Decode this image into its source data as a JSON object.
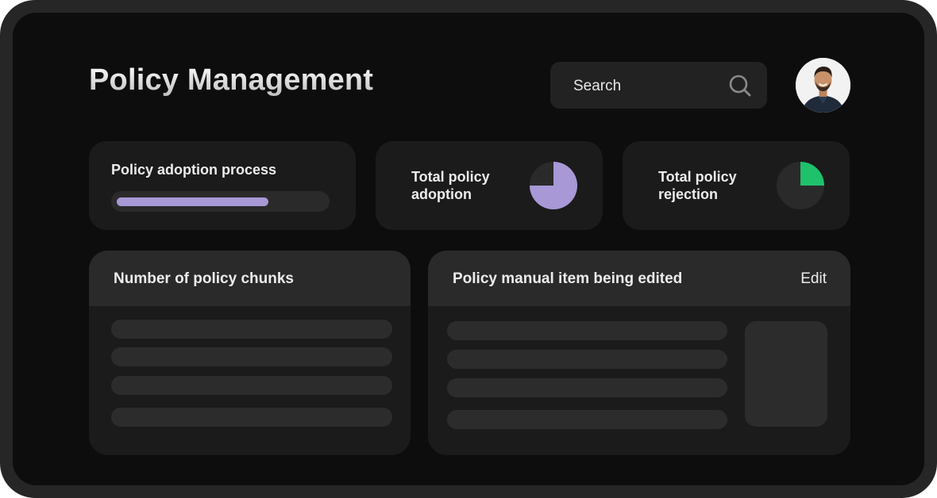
{
  "header": {
    "title": "Policy Management",
    "search_placeholder": "Search",
    "search_icon": "search-icon",
    "avatar_icon": "user-avatar"
  },
  "stats": {
    "adoption_process": {
      "label": "Policy adoption process",
      "progress_percent": 73,
      "color": "#a898d6"
    },
    "total_adoption": {
      "label_line1": "Total policy",
      "label_line2": "adoption",
      "pie_fraction": 0.75,
      "color": "#a898d6"
    },
    "total_rejection": {
      "label_line1": "Total policy",
      "label_line2": "rejection",
      "pie_fraction": 0.25,
      "color": "#1fc16b"
    }
  },
  "panels": {
    "chunks": {
      "title": "Number of policy chunks"
    },
    "manual": {
      "title": "Policy manual item being edited",
      "edit_label": "Edit"
    }
  },
  "colors": {
    "device_frame": "#262626",
    "screen_bg": "#0d0d0d",
    "card_bg": "#1b1b1b",
    "panel_header_bg": "#2a2a2a",
    "accent_purple": "#a898d6",
    "accent_green": "#1fc16b"
  }
}
